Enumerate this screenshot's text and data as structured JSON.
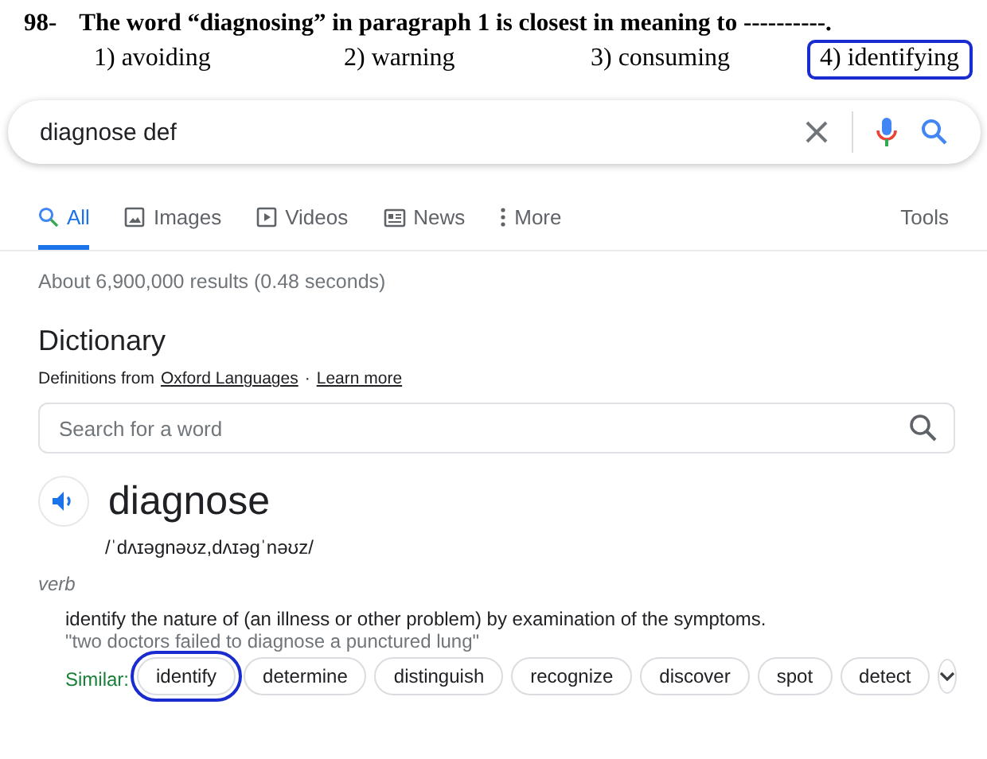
{
  "question": {
    "number": "98-",
    "prompt": "The word “diagnosing” in paragraph 1 is closest in meaning to ----------.",
    "options": [
      {
        "label": "1) avoiding",
        "circled": false
      },
      {
        "label": "2) warning",
        "circled": false
      },
      {
        "label": "3) consuming",
        "circled": false
      },
      {
        "label": "4) identifying",
        "circled": true
      }
    ]
  },
  "search": {
    "value": "diagnose def"
  },
  "tabs": [
    {
      "label": "All",
      "kind": "search",
      "selected": true
    },
    {
      "label": "Images",
      "kind": "image",
      "selected": false
    },
    {
      "label": "Videos",
      "kind": "video",
      "selected": false
    },
    {
      "label": "News",
      "kind": "news",
      "selected": false
    },
    {
      "label": "More",
      "kind": "dots",
      "selected": false
    }
  ],
  "tools": "Tools",
  "result_stats": "About 6,900,000 results (0.48 seconds)",
  "dictionary": {
    "title": "Dictionary",
    "source_prefix": "Definitions from",
    "source_link": "Oxford Languages",
    "separator": "·",
    "learn_more": "Learn more",
    "word_search": {
      "placeholder": "Search for a word"
    },
    "word": "diagnose",
    "phonetic": "/ˈdʌɪəɡnəʊz,dʌɪəɡˈnəʊz/",
    "part_of_speech": "verb",
    "definition": "identify the nature of (an illness or other problem) by examination of the symptoms.",
    "example": "\"two doctors failed to diagnose a punctured lung\"",
    "similar_label": "Similar:",
    "similar": [
      {
        "label": "identify",
        "circled": true
      },
      {
        "label": "determine",
        "circled": false
      },
      {
        "label": "distinguish",
        "circled": false
      },
      {
        "label": "recognize",
        "circled": false
      },
      {
        "label": "discover",
        "circled": false
      },
      {
        "label": "spot",
        "circled": false
      },
      {
        "label": "detect",
        "circled": false
      }
    ]
  }
}
